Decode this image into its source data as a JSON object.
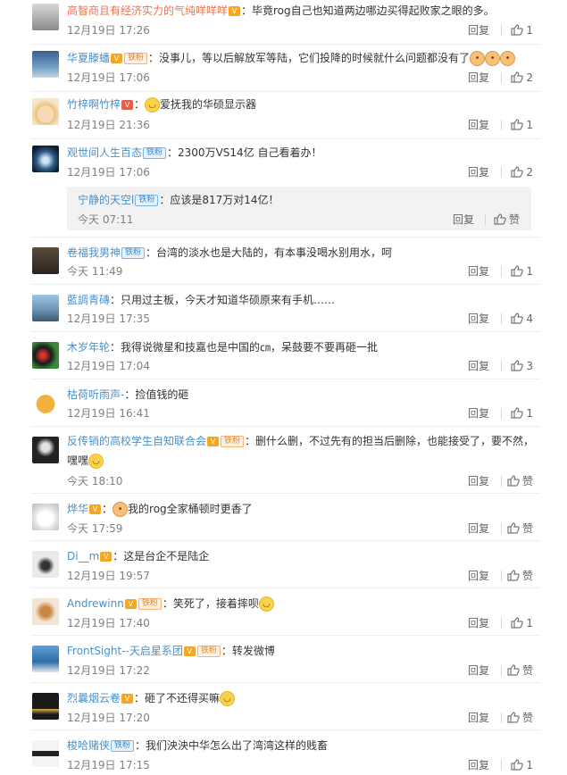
{
  "comments": [
    {
      "name": "高智商且有经济实力的气纯咩咩咩",
      "text": "：毕竟rog自己也知道两边哪边买得起败家之眼的多。",
      "time": "12月19日 17:26",
      "reply": "回复",
      "likes": "1"
    },
    {
      "name": "华夏滕蟠",
      "badge": "铁粉",
      "text": "：没事儿，等以后解放军等陆，它们投降的时候就什么问题都没有了",
      "time": "12月19日 17:06",
      "reply": "回复",
      "likes": "2"
    },
    {
      "name": "竹梓啊竹梓",
      "text": "爱抚我的华硕显示器",
      "time": "12月19日 21:36",
      "reply": "回复",
      "likes": "1"
    },
    {
      "name": "观世间人生百态",
      "badge": "铁粉",
      "text": "：2300万VS14亿 自己看着办！",
      "time": "12月19日 17:06",
      "reply": "回复",
      "likes": "2",
      "nested": {
        "name": "宁静的天空l",
        "badge": "铁粉",
        "text": "：应该是817万对14亿！",
        "time": "今天 07:11",
        "reply": "回复",
        "likes": "赞"
      }
    },
    {
      "name": "卷福我男神",
      "badge": "铁粉",
      "text": "：台湾的淡水也是大陆的，有本事没喝水别用水，呵",
      "time": "今天 11:49",
      "reply": "回复",
      "likes": "1"
    },
    {
      "name": "藍調青磚",
      "text": "：只用过主板，今天才知道华硕原来有手机……",
      "time": "12月19日 17:35",
      "reply": "回复",
      "likes": "4"
    },
    {
      "name": "木岁年轮",
      "text": "：我得说微星和技嘉也是中国的㎝，呆鼓要不要再砸一批",
      "time": "12月19日 17:04",
      "reply": "回复",
      "likes": "3"
    },
    {
      "name": "枯荷听雨声-",
      "text": "：捡值钱的砸",
      "time": "12月19日 16:41",
      "reply": "回复",
      "likes": "1"
    },
    {
      "name": "反传销的高校学生自知联合会",
      "badge": "铁粉",
      "text": "：删什么删，不过先有的担当后删除，也能接受了，要不然，",
      "text2": "嘿嘿",
      "time": "今天 18:10",
      "reply": "回复",
      "likes": "赞"
    },
    {
      "name": "烨华",
      "text": "我的rog全家桶顿时更香了",
      "time": "今天 17:59",
      "reply": "回复",
      "likes": "赞"
    },
    {
      "name": "Di__m",
      "text": "：这是台企不是陆企",
      "time": "12月19日 19:57",
      "reply": "回复",
      "likes": "赞"
    },
    {
      "name": "Andrewinn",
      "badge": "铁粉",
      "text": "：笑死了，接着摔呗",
      "time": "12月19日 17:40",
      "reply": "回复",
      "likes": "1"
    },
    {
      "name": "FrontSight--天启星系团",
      "badge": "铁粉",
      "text": "：转发微博",
      "time": "12月19日 17:22",
      "reply": "回复",
      "likes": "赞"
    },
    {
      "name": "烈曩烟云卷",
      "text": "：砸了不还得买嘛",
      "time": "12月19日 17:20",
      "reply": "回复",
      "likes": "赞"
    },
    {
      "name": "梭哈赌侠",
      "badge": "铁粉",
      "text": "：我们泱泱中华怎么出了湾湾这样的贱畜",
      "time": "12月19日 17:15",
      "reply": "回复",
      "likes": "1"
    }
  ]
}
